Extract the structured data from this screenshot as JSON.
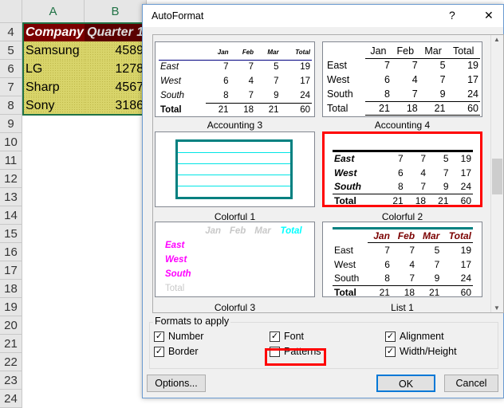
{
  "sheet": {
    "columns": [
      "A",
      "B"
    ],
    "rows": [
      "4",
      "5",
      "6",
      "7",
      "8",
      "9",
      "10",
      "11",
      "12",
      "13",
      "14",
      "15",
      "16",
      "17",
      "18",
      "19",
      "20",
      "21",
      "22",
      "23",
      "24"
    ],
    "header": [
      "Company",
      "Quarter 1"
    ],
    "data": [
      [
        "Samsung",
        "4589"
      ],
      [
        "LG",
        "1278"
      ],
      [
        "Sharp",
        "4567"
      ],
      [
        "Sony",
        "3186"
      ]
    ]
  },
  "dialog": {
    "title": "AutoFormat",
    "help_label": "?",
    "close_label": "✕",
    "sample": {
      "months": [
        "Jan",
        "Feb",
        "Mar",
        "Total"
      ],
      "regions": [
        "East",
        "West",
        "South",
        "Total"
      ],
      "values": [
        [
          "7",
          "7",
          "5",
          "19"
        ],
        [
          "6",
          "4",
          "7",
          "17"
        ],
        [
          "8",
          "7",
          "9",
          "24"
        ],
        [
          "21",
          "18",
          "21",
          "60"
        ]
      ],
      "currency": "$"
    },
    "formats": [
      {
        "name": "Accounting 3",
        "selected": false
      },
      {
        "name": "Accounting 4",
        "selected": false
      },
      {
        "name": "Colorful 1",
        "selected": false
      },
      {
        "name": "Colorful 2",
        "selected": true
      },
      {
        "name": "Colorful 3",
        "selected": false
      },
      {
        "name": "List 1",
        "selected": false
      }
    ],
    "scroll_position": 0.45,
    "formats_to_apply": {
      "label": "Formats to apply",
      "options": [
        {
          "label": "Number",
          "checked": true
        },
        {
          "label": "Font",
          "checked": true
        },
        {
          "label": "Alignment",
          "checked": true
        },
        {
          "label": "Border",
          "checked": true
        },
        {
          "label": "Patterns",
          "checked": false
        },
        {
          "label": "Width/Height",
          "checked": true
        }
      ]
    },
    "buttons": {
      "options": "Options...",
      "ok": "OK",
      "cancel": "Cancel"
    },
    "colors": {
      "highlight": "#ff0000",
      "teal": "#008080",
      "magenta": "#ff00ff",
      "cyan": "#00ffff",
      "header_red": "#7b0000"
    }
  }
}
